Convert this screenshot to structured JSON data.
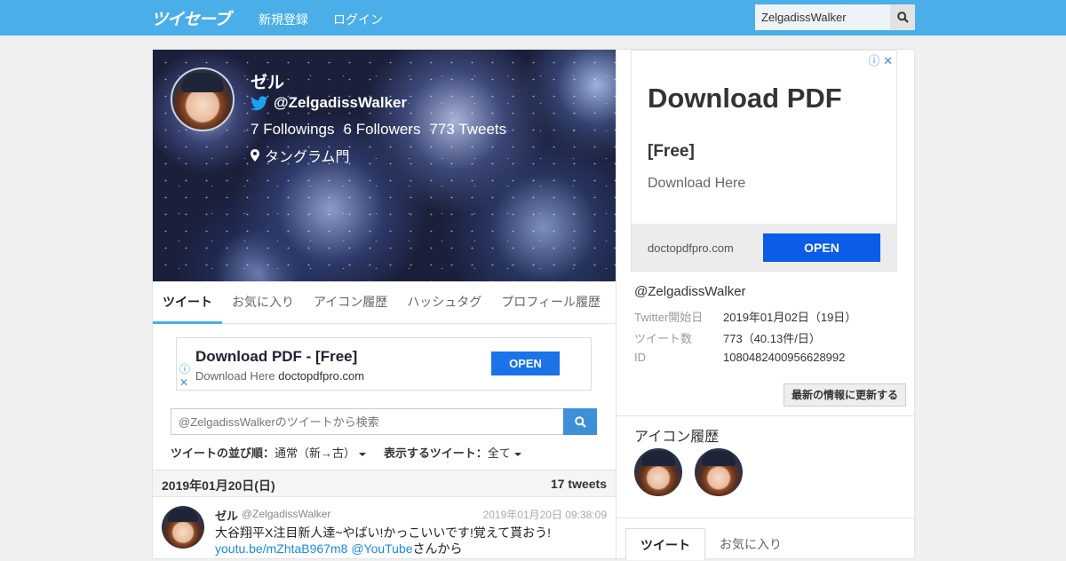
{
  "header": {
    "logo": "ツイセーブ",
    "nav": [
      "新規登録",
      "ログイン"
    ],
    "search_value": "ZelgadissWalker"
  },
  "profile": {
    "name": "ゼル",
    "handle": "@ZelgadissWalker",
    "followings": "7",
    "followings_label": "Followings",
    "followers": "6",
    "followers_label": "Followers",
    "tweets": "773",
    "tweets_label": "Tweets",
    "location": "タングラム門"
  },
  "tabs": [
    "ツイート",
    "お気に入り",
    "アイコン履歴",
    "ハッシュタグ",
    "プロフィール履歴"
  ],
  "ad_inline": {
    "title": "Download PDF - [Free]",
    "subtitle_prefix": "Download Here",
    "domain": "doctopdfpro.com",
    "button": "OPEN"
  },
  "tweet_search": {
    "placeholder": "@ZelgadissWalkerのツイートから検索"
  },
  "sort": {
    "order_label": "ツイートの並び順：",
    "order_value": "通常（新→古）",
    "filter_label": "表示するツイート：",
    "filter_value": "全て"
  },
  "day": {
    "date": "2019年01月20日(日)",
    "count": "17 tweets"
  },
  "tweet": {
    "name": "ゼル",
    "handle": "@ZelgadissWalker",
    "time": "2019年01月20日 09:38:09",
    "text_before": "大谷翔平X注目新人達~やばい!かっこいいです!覚えて貰おう! ",
    "link": "youtu.be/mZhtaB967m8",
    "mention": "@YouTube",
    "text_after": "さんから"
  },
  "ad_side": {
    "headline": "Download PDF",
    "free": "[Free]",
    "sub": "Download Here",
    "domain": "doctopdfpro.com",
    "button": "OPEN"
  },
  "info": {
    "handle": "@ZelgadissWalker",
    "rows": [
      {
        "k": "Twitter開始日",
        "v": "2019年01月02日（19日）"
      },
      {
        "k": "ツイート数",
        "v": "773（40.13件/日）"
      },
      {
        "k": "ID",
        "v": "1080482400956628992"
      }
    ],
    "refresh": "最新の情報に更新する"
  },
  "icon_history": {
    "title": "アイコン履歴"
  },
  "right_tabs": [
    "ツイート",
    "お気に入り"
  ],
  "colors": {
    "topbar": "#4aaee8",
    "accent": "#4aaee8",
    "link": "#1a8bd8",
    "ad_button": "#0b5ce6"
  }
}
